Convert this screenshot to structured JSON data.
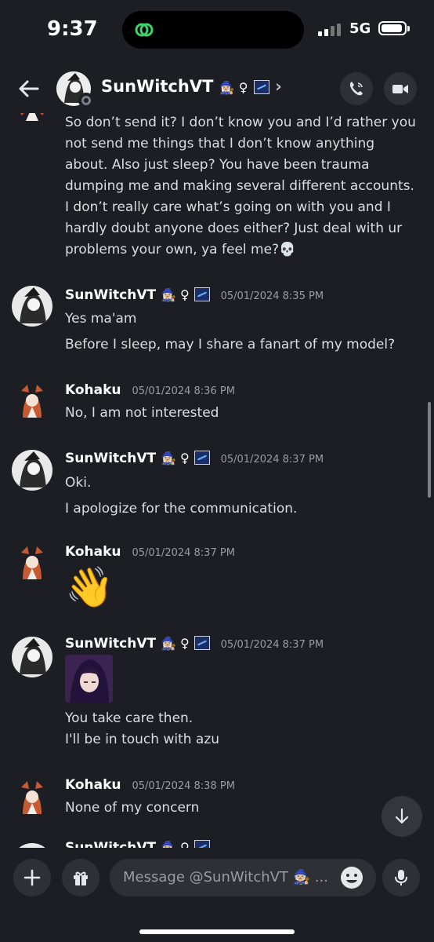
{
  "status_bar": {
    "time": "9:37",
    "network": "5G"
  },
  "header": {
    "back_label": "back",
    "name": "SunWitchVT",
    "name_emoji": "🧙🏼‍♀️ ♀",
    "chevron": "›"
  },
  "messages": [
    {
      "type": "continuation",
      "lines": [
        "So don’t send it? I don’t know you and I’d rather you",
        "not send me things that I don’t know anything",
        "about. Also just sleep? You have been trauma",
        "dumping me and making several different accounts.",
        "I don’t really care what’s going on with you and I",
        "hardly doubt anyone does either? Just deal with ur",
        "problems your own, ya feel me?💀"
      ]
    },
    {
      "author": "SunWitchVT",
      "author_emoji": "🧙🏼‍♀️ ♀",
      "timestamp": "05/01/2024 8:35 PM",
      "lines": [
        "Yes ma'am",
        "Before I sleep, may I share a fanart of my model?"
      ]
    },
    {
      "author": "Kohaku",
      "timestamp": "05/01/2024 8:36 PM",
      "lines": [
        "No, I am not interested"
      ]
    },
    {
      "author": "SunWitchVT",
      "author_emoji": "🧙🏼‍♀️ ♀",
      "timestamp": "05/01/2024 8:37 PM",
      "lines": [
        "Oki.",
        "I apologize for the communication."
      ]
    },
    {
      "author": "Kohaku",
      "timestamp": "05/01/2024 8:37 PM",
      "emoji": "👋"
    },
    {
      "author": "SunWitchVT",
      "author_emoji": "🧙🏼‍♀️ ♀",
      "timestamp": "05/01/2024 8:37 PM",
      "lines": [
        "You take care then.",
        "I'll be in touch with azu"
      ]
    },
    {
      "author": "Kohaku",
      "timestamp": "05/01/2024 8:38 PM",
      "lines": [
        "None of my concern"
      ]
    },
    {
      "author": "SunWitchVT",
      "author_emoji": "🧙🏼‍♀️ ♀"
    }
  ],
  "composer": {
    "placeholder": "Message @SunWitchVT 🧙🏼 ..."
  },
  "colors": {
    "background": "#1d1e23",
    "button": "#2e3036",
    "text": "#dcdde0",
    "muted": "#9a9ca3"
  }
}
